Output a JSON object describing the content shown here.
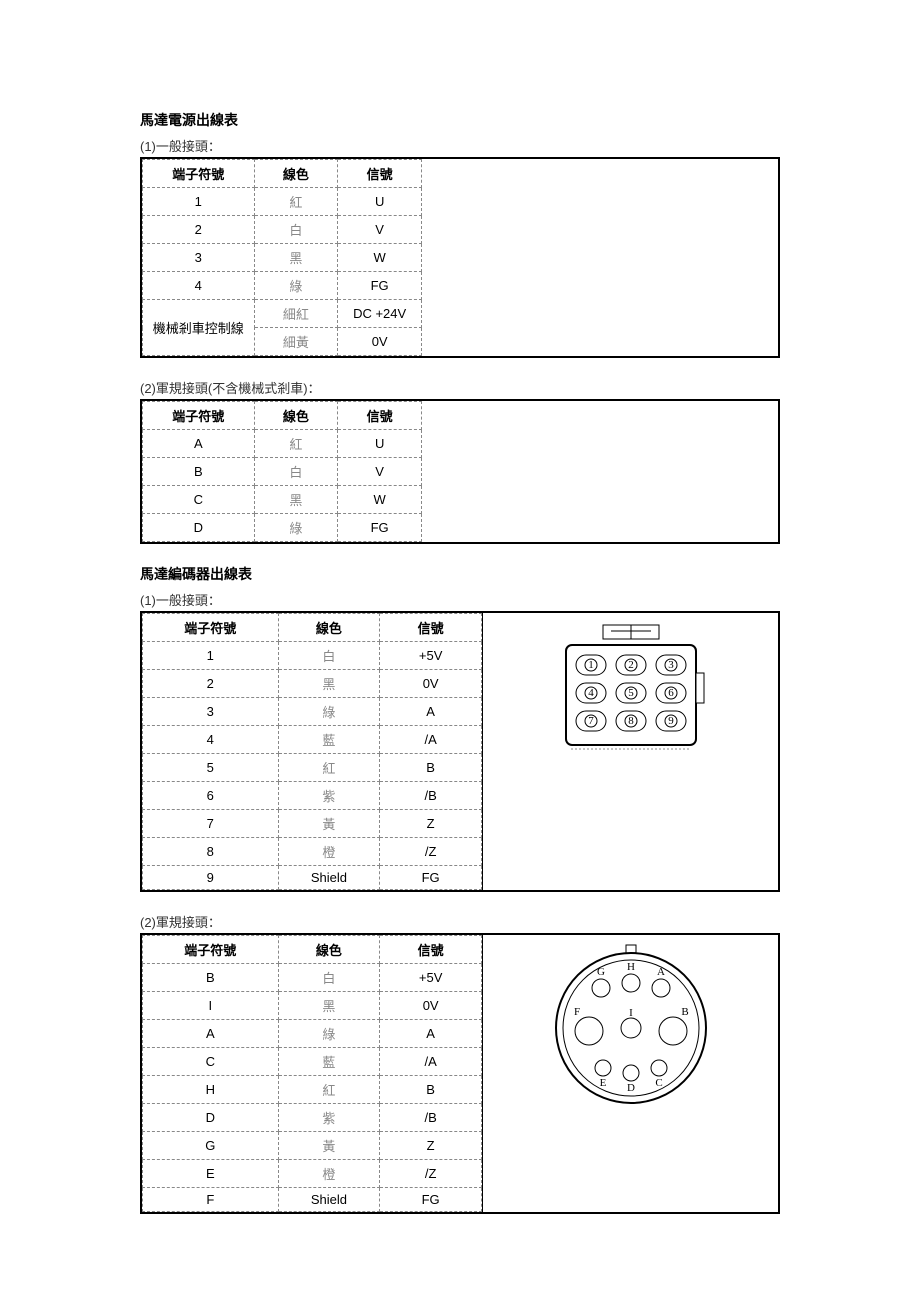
{
  "section1": {
    "title": "馬達電源出線表",
    "sub1": "(1)一般接頭：",
    "t1": {
      "h1": "端子符號",
      "h2": "線色",
      "h3": "信號",
      "rows": [
        {
          "a": "1",
          "b": "紅",
          "c": "U"
        },
        {
          "a": "2",
          "b": "白",
          "c": "V"
        },
        {
          "a": "3",
          "b": "黑",
          "c": "W"
        },
        {
          "a": "4",
          "b": "綠",
          "c": "FG"
        }
      ],
      "brake_label": "機械剎車控制線",
      "brake1": {
        "b": "細紅",
        "c": "DC +24V"
      },
      "brake2": {
        "b": "細黃",
        "c": "0V"
      }
    },
    "sub2": "(2)軍規接頭(不含機械式剎車)：",
    "t2": {
      "h1": "端子符號",
      "h2": "線色",
      "h3": "信號",
      "rows": [
        {
          "a": "A",
          "b": "紅",
          "c": "U"
        },
        {
          "a": "B",
          "b": "白",
          "c": "V"
        },
        {
          "a": "C",
          "b": "黑",
          "c": "W"
        },
        {
          "a": "D",
          "b": "綠",
          "c": "FG"
        }
      ]
    }
  },
  "section2": {
    "title": "馬達編碼器出線表",
    "sub1": "(1)一般接頭：",
    "t1": {
      "h1": "端子符號",
      "h2": "線色",
      "h3": "信號",
      "rows": [
        {
          "a": "1",
          "b": "白",
          "c": "+5V"
        },
        {
          "a": "2",
          "b": "黑",
          "c": "0V"
        },
        {
          "a": "3",
          "b": "綠",
          "c": "A"
        },
        {
          "a": "4",
          "b": "藍",
          "c": "/A"
        },
        {
          "a": "5",
          "b": "紅",
          "c": "B"
        },
        {
          "a": "6",
          "b": "紫",
          "c": "/B"
        },
        {
          "a": "7",
          "b": "黃",
          "c": "Z"
        },
        {
          "a": "8",
          "b": "橙",
          "c": "/Z"
        },
        {
          "a": "9",
          "b": "Shield",
          "c": "FG"
        }
      ]
    },
    "sub2": "(2)軍規接頭：",
    "t2": {
      "h1": "端子符號",
      "h2": "線色",
      "h3": "信號",
      "rows": [
        {
          "a": "B",
          "b": "白",
          "c": "+5V"
        },
        {
          "a": "I",
          "b": "黑",
          "c": "0V"
        },
        {
          "a": "A",
          "b": "綠",
          "c": "A"
        },
        {
          "a": "C",
          "b": "藍",
          "c": "/A"
        },
        {
          "a": "H",
          "b": "紅",
          "c": "B"
        },
        {
          "a": "D",
          "b": "紫",
          "c": "/B"
        },
        {
          "a": "G",
          "b": "黃",
          "c": "Z"
        },
        {
          "a": "E",
          "b": "橙",
          "c": "/Z"
        },
        {
          "a": "F",
          "b": "Shield",
          "c": "FG"
        }
      ]
    }
  },
  "diag9": {
    "labels": [
      "1",
      "2",
      "3",
      "4",
      "5",
      "6",
      "7",
      "8",
      "9"
    ]
  },
  "diagCirc": {
    "labels": [
      "G",
      "H",
      "A",
      "F",
      "I",
      "B",
      "E",
      "D",
      "C"
    ]
  }
}
